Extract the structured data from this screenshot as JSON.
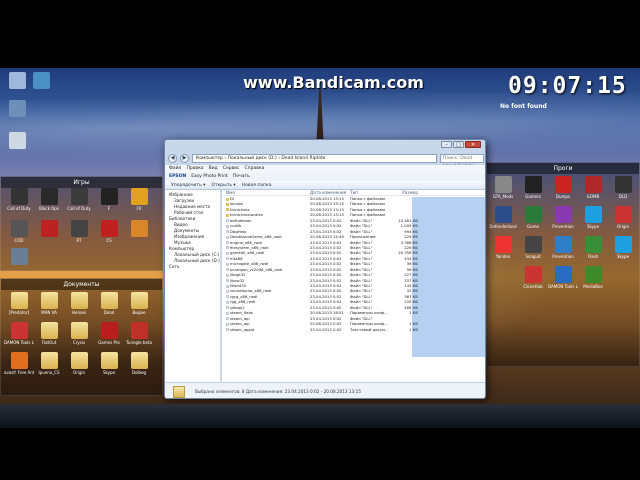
{
  "overlay": {
    "watermark": "www.Bandicam.com",
    "clock": "09:07:15",
    "no_font": "No font found"
  },
  "fences": {
    "games": {
      "title": "Игры",
      "icons": [
        "Call of Duty",
        "Black Ops",
        "Call of Duty",
        "F",
        "FX",
        "COD",
        "",
        "RT",
        "CS",
        "",
        ""
      ]
    },
    "docs": {
      "title": "Документы",
      "icons": [
        "[Predator]",
        "MAN VA",
        "Heroes",
        "Dead",
        "Видео",
        "DAMON Tools Lite",
        "FlatOut",
        "Crysis",
        "Games Pro",
        "Tunngle beta",
        "avast! Free Antivirus",
        "Ipuena_CS",
        "Origin",
        "Skype",
        "Dolbeg"
      ]
    },
    "progs": {
      "title": "Проги",
      "icons": [
        "GTA_Mods",
        "Gamerz",
        "Dumps",
        "GOMB",
        "DLD",
        "Defenderland",
        "Game",
        "Prevention",
        "Skype",
        "Origin",
        "Yandex",
        "Snaguit",
        "Prevention",
        "Flash",
        "Skype",
        "CloneHub",
        "DAMON Tools Lite",
        "MediaBox"
      ]
    }
  },
  "explorer": {
    "breadcrumb": "Компьютер › Локальный диск (D:) › Dead Island Riptide",
    "search_placeholder": "Поиск: Dead Island Riptide",
    "menu": [
      "Файл",
      "Правка",
      "Вид",
      "Сервис",
      "Справка"
    ],
    "appbar": [
      "EPSON",
      "Easy Photo Print",
      "Печать"
    ],
    "toolbar": [
      "Упорядочить ▾",
      "Открыть ▾",
      "Новая папка"
    ],
    "nav": [
      {
        "label": "Избранное",
        "sub": false
      },
      {
        "label": "Загрузки",
        "sub": true
      },
      {
        "label": "Недавние места",
        "sub": true
      },
      {
        "label": "Рабочий стол",
        "sub": true
      },
      {
        "label": "",
        "sub": false
      },
      {
        "label": "Библиотеки",
        "sub": false
      },
      {
        "label": "Видео",
        "sub": true
      },
      {
        "label": "Документы",
        "sub": true
      },
      {
        "label": "Изображения",
        "sub": true
      },
      {
        "label": "Музыка",
        "sub": true
      },
      {
        "label": "",
        "sub": false
      },
      {
        "label": "Компьютер",
        "sub": false
      },
      {
        "label": "Локальный диск (C:)",
        "sub": true
      },
      {
        "label": "Локальный диск (D:)",
        "sub": true
      },
      {
        "label": "",
        "sub": false
      },
      {
        "label": "Сеть",
        "sub": false
      }
    ],
    "columns": [
      "Имя",
      "Дата изменения",
      "Тип",
      "Размер"
    ],
    "files": [
      {
        "name": "DI",
        "date": "20.08.2013 13:15",
        "type": "Папка с файлами",
        "size": "",
        "folder": true
      },
      {
        "name": "locales",
        "date": "20.08.2013 13:15",
        "type": "Папка с файлами",
        "size": "",
        "folder": true
      },
      {
        "name": "thirdchess",
        "date": "20.08.2013 13:15",
        "type": "Папка с файлами",
        "size": "",
        "folder": true
      },
      {
        "name": "thirdchesslocales",
        "date": "20.08.2013 13:15",
        "type": "Папка с файлами",
        "size": "",
        "folder": true
      },
      {
        "name": "bethdebian",
        "date": "23.04.2013 0:02",
        "type": "Файл \"DLL\"",
        "size": "10 481 КБ",
        "folder": false
      },
      {
        "name": "cudlib",
        "date": "23.04.2013 0:02",
        "type": "Файл \"DLL\"",
        "size": "1 005 КБ",
        "folder": false
      },
      {
        "name": "DbgHelp",
        "date": "23.04.2013 0:02",
        "type": "Файл \"DLL\"",
        "size": "994 КБ",
        "folder": false
      },
      {
        "name": "DeadIslandGame_x86_rwdi",
        "date": "20.08.2013 14:49",
        "type": "Приложение",
        "size": "229 КБ",
        "folder": false
      },
      {
        "name": "engine_x86_rwdi",
        "date": "23.04.2013 0:02",
        "type": "Файл \"DLL\"",
        "size": "4 388 КБ",
        "folder": false
      },
      {
        "name": "filesystem_x86_rwdi",
        "date": "23.04.2013 0:02",
        "type": "Файл \"DLL\"",
        "size": "226 КБ",
        "folder": false
      },
      {
        "name": "gamedll_x86_rwdi",
        "date": "23.04.2013 0:02",
        "type": "Файл \"DLL\"",
        "size": "29 358 КБ",
        "folder": false
      },
      {
        "name": "mss86",
        "date": "23.04.2013 0:02",
        "type": "Файл \"DLL\"",
        "size": "434 КБ",
        "folder": false
      },
      {
        "name": "microgate_x86_rwdi",
        "date": "23.04.2013 0:02",
        "type": "Файл \"DLL\"",
        "size": "36 КБ",
        "folder": false
      },
      {
        "name": "pcomgoo_vc2008_x86_rwdi",
        "date": "23.04.2013 0:02",
        "type": "Файл \"DLL\"",
        "size": "96 КБ",
        "folder": false
      },
      {
        "name": "libopt32",
        "date": "23.04.2013 0:02",
        "type": "Файл \"DLL\"",
        "size": "227 КБ",
        "folder": false
      },
      {
        "name": "libzw32",
        "date": "23.04.2013 0:02",
        "type": "Файл \"DLL\"",
        "size": "337 КБ",
        "folder": false
      },
      {
        "name": "libsnd32",
        "date": "23.04.2013 0:02",
        "type": "Файл \"DLL\"",
        "size": "145 КБ",
        "folder": false
      },
      {
        "name": "sounddump_x86_rwdi",
        "date": "23.04.2013 0:02",
        "type": "Файл \"DLL\"",
        "size": "32 КБ",
        "folder": false
      },
      {
        "name": "rgcg_x86_rwdi",
        "date": "23.04.2013 0:02",
        "type": "Файл \"DLL\"",
        "size": "367 КБ",
        "folder": false
      },
      {
        "name": "rgg_x86_rwdi",
        "date": "23.04.2013 0:02",
        "type": "Файл \"DLL\"",
        "size": "226 КБ",
        "folder": false
      },
      {
        "name": "sdkapi2",
        "date": "23.04.2013 0:02",
        "type": "Файл \"DLL\"",
        "size": "486 КБ",
        "folder": false
      },
      {
        "name": "steam_flake",
        "date": "20.08.2013 18:51",
        "type": "Параметры конф...",
        "size": "1 КБ",
        "folder": false
      },
      {
        "name": "steam_api",
        "date": "23.04.2013 0:02",
        "type": "Файл \"DLL\"",
        "size": "",
        "folder": false
      },
      {
        "name": "steam_api",
        "date": "25.08.2013 0:02",
        "type": "Параметры конф...",
        "size": "1 КБ",
        "folder": false
      },
      {
        "name": "steam_appid",
        "date": "23.04.2013 0:02",
        "type": "Текстовый докум...",
        "size": "1 КБ",
        "folder": false
      }
    ],
    "status": "Выбрано элементов: 8    Дата изменения: 23.04.2013 0:02 - 20.08.2013 13:15"
  }
}
